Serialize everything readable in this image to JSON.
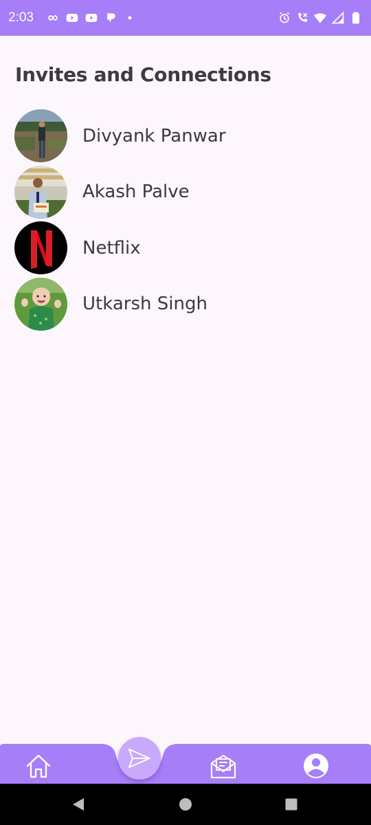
{
  "status_bar": {
    "time": "2:03",
    "left_icons": [
      "infinity-icon",
      "youtube-icon",
      "youtube-icon",
      "notification-icon",
      "dot-icon"
    ],
    "right_icons": [
      "alarm-icon",
      "wifi-calling-icon",
      "wifi-icon",
      "signal-icon",
      "battery-icon"
    ]
  },
  "page": {
    "title": "Invites and Connections"
  },
  "contacts": [
    {
      "name": "Divyank Panwar",
      "avatar": "photo-avatar"
    },
    {
      "name": "Akash Palve",
      "avatar": "photo-avatar"
    },
    {
      "name": "Netflix",
      "avatar": "netflix-logo"
    },
    {
      "name": "Utkarsh Singh",
      "avatar": "photo-avatar"
    }
  ],
  "bottom_nav": {
    "items": [
      "home-icon",
      "send-icon",
      "inbox-icon",
      "profile-icon"
    ],
    "active": "send-icon"
  },
  "system_nav": {
    "items": [
      "back-icon",
      "home-circle-icon",
      "recents-icon"
    ]
  },
  "colors": {
    "accent": "#a57ef8",
    "fab": "#c9a9fc",
    "background": "#fdf7fd",
    "text": "#3b393d"
  }
}
